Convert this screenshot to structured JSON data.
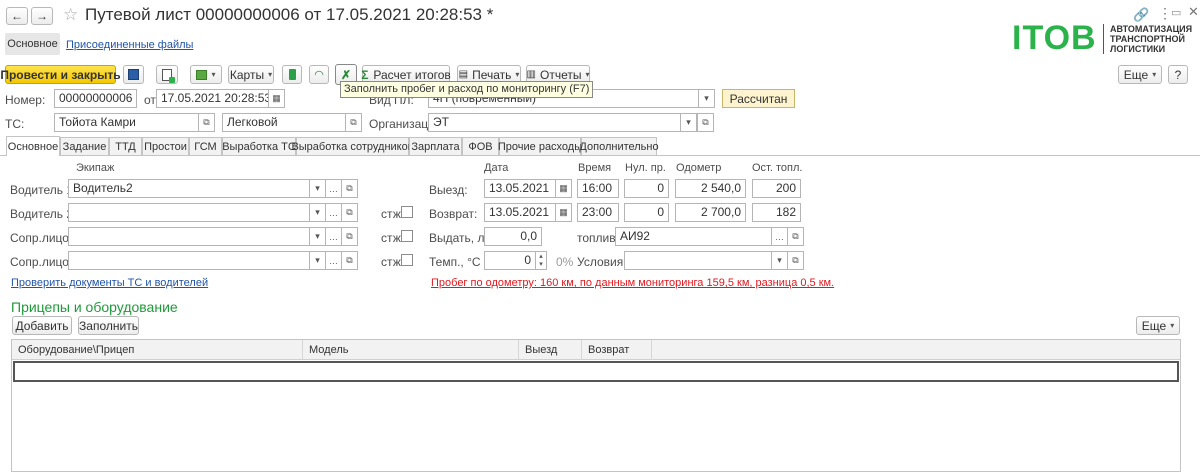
{
  "window": {
    "title": "Путевой лист 00000000006 от 17.05.2021 20:28:53 *"
  },
  "logo": {
    "mark": "ITOB",
    "line1": "АВТОМАТИЗАЦИЯ",
    "line2": "ТРАНСПОРТНОЙ",
    "line3": "ЛОГИСТИКИ"
  },
  "subnav": {
    "main": "Основное",
    "files": "Присоединенные файлы"
  },
  "toolbar": {
    "post_close": "Провести и закрыть",
    "cards": "Карты",
    "calc_totals": "Расчет итогов",
    "print": "Печать",
    "reports": "Отчеты",
    "more": "Еще",
    "help": "?",
    "tooltip": "Заполнить пробег и расход по мониторингу (F7)"
  },
  "header": {
    "number_label": "Номер:",
    "number": "00000000006",
    "from_label": "от:",
    "date": "17.05.2021 20:28:53",
    "kind_label": "Вид ПЛ:",
    "kind": "4П (повременный)",
    "status": "Рассчитан",
    "ts_label": "ТС:",
    "ts": "Тойота Камри",
    "ts_type": "Легковой",
    "org_label": "Организация:",
    "org": "ЭТ"
  },
  "tabs": [
    "Основное",
    "Задание",
    "ТТД",
    "Простои",
    "ГСМ",
    "Выработка ТС",
    "Выработка сотрудников",
    "Зарплата",
    "ФОВ",
    "Прочие расходы",
    "Дополнительно"
  ],
  "crew": {
    "header": "Экипаж",
    "driver1_label": "Водитель 1:",
    "driver1": "Водитель2",
    "driver2_label": "Водитель 2:",
    "escort1_label": "Сопр.лицо 1:",
    "escort2_label": "Сопр.лицо 2:",
    "stzh_label": "стж:",
    "check_link": "Проверить документы ТС и водителей"
  },
  "trip": {
    "col_date": "Дата",
    "col_time": "Время",
    "col_zero": "Нул. пр.",
    "col_odometer": "Одометр",
    "col_fuel_left": "Ост. топл.",
    "departure_label": "Выезд:",
    "departure_date": "13.05.2021",
    "departure_time": "16:00",
    "departure_zero": "0",
    "departure_odometer": "2 540,0",
    "departure_fuel": "200",
    "return_label": "Возврат:",
    "return_date": "13.05.2021",
    "return_time": "23:00",
    "return_zero": "0",
    "return_odometer": "2 700,0",
    "return_fuel": "182",
    "issue_label": "Выдать, л",
    "issue_value": "0,0",
    "fuel_label": "топлива:",
    "fuel": "АИ92",
    "temp_label": "Темп., °С",
    "temp_value": "0",
    "percent": "0%",
    "conditions_label": "Условия:",
    "warning": "Пробег по одометру: 160 км, по данным мониторинга 159,5 км, разница 0,5 км."
  },
  "trailers": {
    "title": "Прицепы и оборудование",
    "add": "Добавить",
    "fill": "Заполнить",
    "more": "Еще",
    "columns": [
      "Оборудование\\Прицеп",
      "Модель",
      "Выезд",
      "Возврат"
    ]
  }
}
